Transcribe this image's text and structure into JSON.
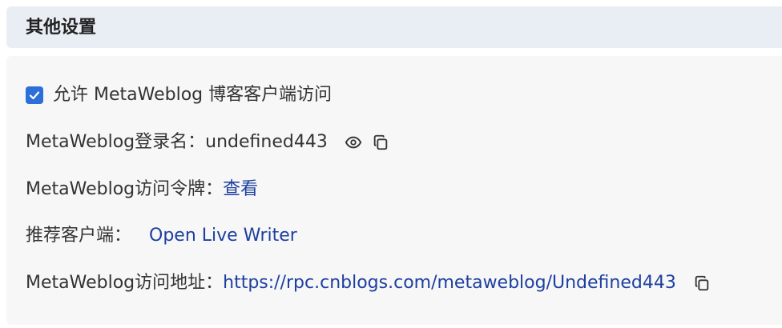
{
  "section": {
    "title": "其他设置"
  },
  "settings": {
    "allow_metaweblog": {
      "checked": true,
      "label": "允许 MetaWeblog 博客客户端访问"
    },
    "login_name": {
      "label": "MetaWeblog登录名：",
      "value": "undefined443",
      "icons": [
        "eye-icon",
        "copy-icon"
      ]
    },
    "access_token": {
      "label": "MetaWeblog访问令牌：",
      "link_text": "查看"
    },
    "recommended_client": {
      "label": "推荐客户端：",
      "link_text": "Open Live Writer"
    },
    "access_url": {
      "label": "MetaWeblog访问地址：",
      "link_text": "https://rpc.cnblogs.com/metaweblog/Undefined443",
      "icons": [
        "copy-icon"
      ]
    }
  },
  "colors": {
    "header_bg": "#e9eef5",
    "panel_bg": "#f7f7f7",
    "checkbox": "#2d6fd8",
    "link": "#1d3fa0"
  }
}
